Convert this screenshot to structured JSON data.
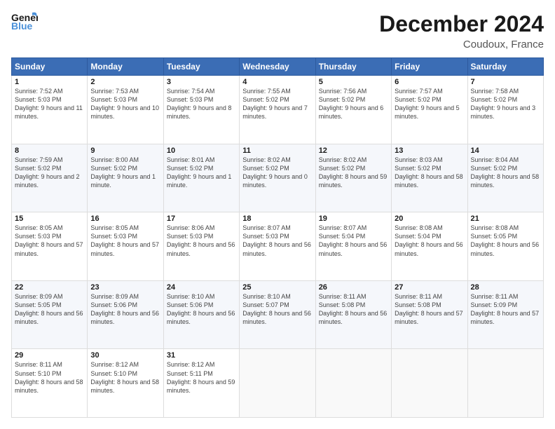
{
  "header": {
    "logo_line1": "General",
    "logo_line2": "Blue",
    "month_title": "December 2024",
    "location": "Coudoux, France"
  },
  "weekdays": [
    "Sunday",
    "Monday",
    "Tuesday",
    "Wednesday",
    "Thursday",
    "Friday",
    "Saturday"
  ],
  "weeks": [
    [
      {
        "day": "1",
        "sunrise": "7:52 AM",
        "sunset": "5:03 PM",
        "daylight": "9 hours and 11 minutes."
      },
      {
        "day": "2",
        "sunrise": "7:53 AM",
        "sunset": "5:03 PM",
        "daylight": "9 hours and 10 minutes."
      },
      {
        "day": "3",
        "sunrise": "7:54 AM",
        "sunset": "5:03 PM",
        "daylight": "9 hours and 8 minutes."
      },
      {
        "day": "4",
        "sunrise": "7:55 AM",
        "sunset": "5:02 PM",
        "daylight": "9 hours and 7 minutes."
      },
      {
        "day": "5",
        "sunrise": "7:56 AM",
        "sunset": "5:02 PM",
        "daylight": "9 hours and 6 minutes."
      },
      {
        "day": "6",
        "sunrise": "7:57 AM",
        "sunset": "5:02 PM",
        "daylight": "9 hours and 5 minutes."
      },
      {
        "day": "7",
        "sunrise": "7:58 AM",
        "sunset": "5:02 PM",
        "daylight": "9 hours and 3 minutes."
      }
    ],
    [
      {
        "day": "8",
        "sunrise": "7:59 AM",
        "sunset": "5:02 PM",
        "daylight": "9 hours and 2 minutes."
      },
      {
        "day": "9",
        "sunrise": "8:00 AM",
        "sunset": "5:02 PM",
        "daylight": "9 hours and 1 minute."
      },
      {
        "day": "10",
        "sunrise": "8:01 AM",
        "sunset": "5:02 PM",
        "daylight": "9 hours and 1 minute."
      },
      {
        "day": "11",
        "sunrise": "8:02 AM",
        "sunset": "5:02 PM",
        "daylight": "9 hours and 0 minutes."
      },
      {
        "day": "12",
        "sunrise": "8:02 AM",
        "sunset": "5:02 PM",
        "daylight": "8 hours and 59 minutes."
      },
      {
        "day": "13",
        "sunrise": "8:03 AM",
        "sunset": "5:02 PM",
        "daylight": "8 hours and 58 minutes."
      },
      {
        "day": "14",
        "sunrise": "8:04 AM",
        "sunset": "5:02 PM",
        "daylight": "8 hours and 58 minutes."
      }
    ],
    [
      {
        "day": "15",
        "sunrise": "8:05 AM",
        "sunset": "5:03 PM",
        "daylight": "8 hours and 57 minutes."
      },
      {
        "day": "16",
        "sunrise": "8:05 AM",
        "sunset": "5:03 PM",
        "daylight": "8 hours and 57 minutes."
      },
      {
        "day": "17",
        "sunrise": "8:06 AM",
        "sunset": "5:03 PM",
        "daylight": "8 hours and 56 minutes."
      },
      {
        "day": "18",
        "sunrise": "8:07 AM",
        "sunset": "5:03 PM",
        "daylight": "8 hours and 56 minutes."
      },
      {
        "day": "19",
        "sunrise": "8:07 AM",
        "sunset": "5:04 PM",
        "daylight": "8 hours and 56 minutes."
      },
      {
        "day": "20",
        "sunrise": "8:08 AM",
        "sunset": "5:04 PM",
        "daylight": "8 hours and 56 minutes."
      },
      {
        "day": "21",
        "sunrise": "8:08 AM",
        "sunset": "5:05 PM",
        "daylight": "8 hours and 56 minutes."
      }
    ],
    [
      {
        "day": "22",
        "sunrise": "8:09 AM",
        "sunset": "5:05 PM",
        "daylight": "8 hours and 56 minutes."
      },
      {
        "day": "23",
        "sunrise": "8:09 AM",
        "sunset": "5:06 PM",
        "daylight": "8 hours and 56 minutes."
      },
      {
        "day": "24",
        "sunrise": "8:10 AM",
        "sunset": "5:06 PM",
        "daylight": "8 hours and 56 minutes."
      },
      {
        "day": "25",
        "sunrise": "8:10 AM",
        "sunset": "5:07 PM",
        "daylight": "8 hours and 56 minutes."
      },
      {
        "day": "26",
        "sunrise": "8:11 AM",
        "sunset": "5:08 PM",
        "daylight": "8 hours and 56 minutes."
      },
      {
        "day": "27",
        "sunrise": "8:11 AM",
        "sunset": "5:08 PM",
        "daylight": "8 hours and 57 minutes."
      },
      {
        "day": "28",
        "sunrise": "8:11 AM",
        "sunset": "5:09 PM",
        "daylight": "8 hours and 57 minutes."
      }
    ],
    [
      {
        "day": "29",
        "sunrise": "8:11 AM",
        "sunset": "5:10 PM",
        "daylight": "8 hours and 58 minutes."
      },
      {
        "day": "30",
        "sunrise": "8:12 AM",
        "sunset": "5:10 PM",
        "daylight": "8 hours and 58 minutes."
      },
      {
        "day": "31",
        "sunrise": "8:12 AM",
        "sunset": "5:11 PM",
        "daylight": "8 hours and 59 minutes."
      },
      null,
      null,
      null,
      null
    ]
  ]
}
